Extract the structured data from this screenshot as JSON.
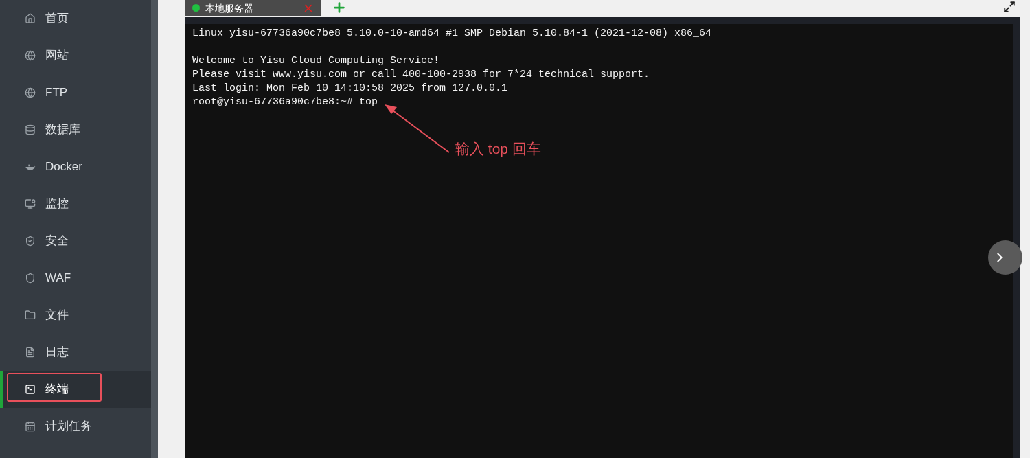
{
  "sidebar": {
    "items": [
      {
        "label": "首页",
        "selected": false,
        "highlighted": false
      },
      {
        "label": "网站",
        "selected": false,
        "highlighted": false
      },
      {
        "label": "FTP",
        "selected": false,
        "highlighted": false
      },
      {
        "label": "数据库",
        "selected": false,
        "highlighted": false
      },
      {
        "label": "Docker",
        "selected": false,
        "highlighted": false
      },
      {
        "label": "监控",
        "selected": false,
        "highlighted": false
      },
      {
        "label": "安全",
        "selected": false,
        "highlighted": false
      },
      {
        "label": "WAF",
        "selected": false,
        "highlighted": false
      },
      {
        "label": "文件",
        "selected": false,
        "highlighted": false
      },
      {
        "label": "日志",
        "selected": false,
        "highlighted": false
      },
      {
        "label": "终端",
        "selected": true,
        "highlighted": true
      },
      {
        "label": "计划任务",
        "selected": false,
        "highlighted": false
      }
    ]
  },
  "tabs": [
    {
      "title": "本地服务器",
      "selected": true,
      "connected": true
    }
  ],
  "terminal": {
    "blocks": [
      [
        "Linux yisu-67736a90c7be8 5.10.0-10-amd64 #1 SMP Debian 5.10.84-1 (2021-12-08) x86_64"
      ],
      [
        "Welcome to Yisu Cloud Computing Service!",
        "Please visit www.yisu.com or call 400-100-2938 for 7*24 technical support.",
        "Last login: Mon Feb 10 14:10:58 2025 from 127.0.0.1",
        "root@yisu-67736a90c7be8:~# top"
      ]
    ]
  },
  "annotation": {
    "text": "输入 top 回车"
  }
}
